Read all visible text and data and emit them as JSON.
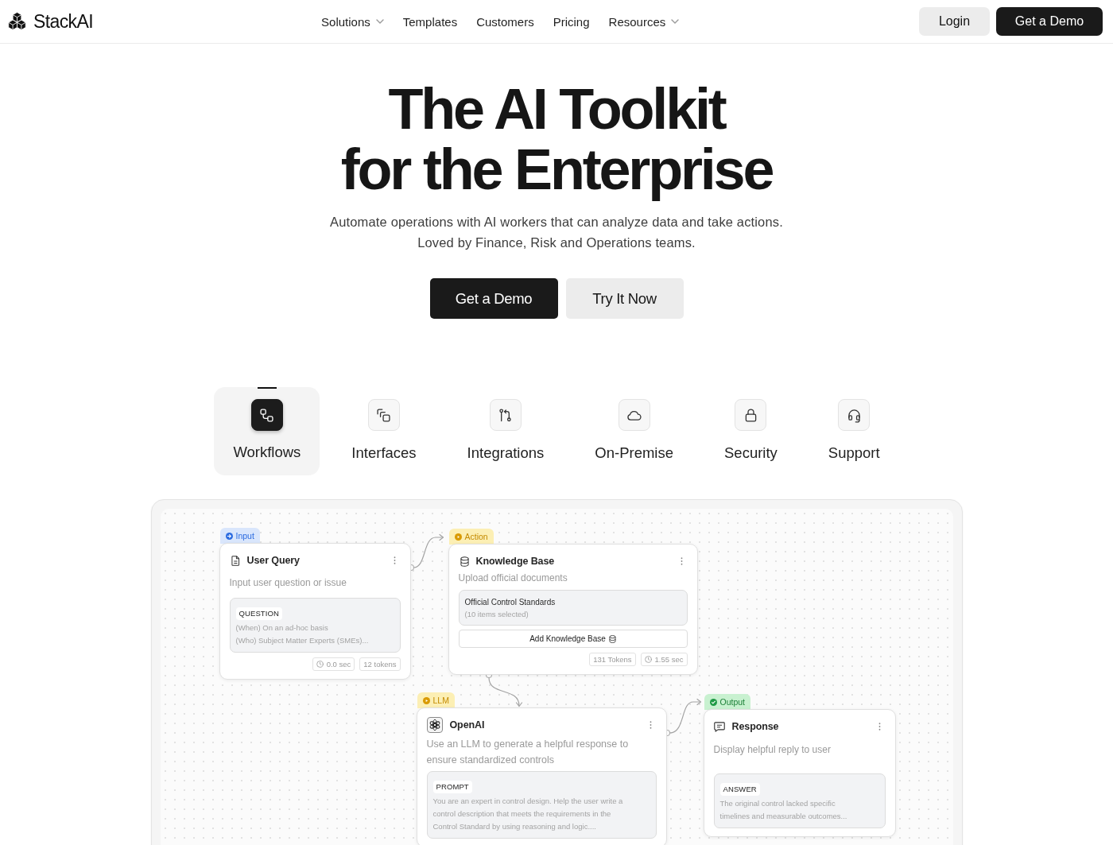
{
  "header": {
    "logo": "StackAI",
    "nav": [
      {
        "label": "Solutions",
        "dropdown": true
      },
      {
        "label": "Templates",
        "dropdown": false
      },
      {
        "label": "Customers",
        "dropdown": false
      },
      {
        "label": "Pricing",
        "dropdown": false
      },
      {
        "label": "Resources",
        "dropdown": true
      }
    ],
    "buttons": [
      {
        "label": "Login",
        "kind": "secondary"
      },
      {
        "label": "Get a Demo",
        "kind": "primary"
      }
    ]
  },
  "hero": {
    "title_lines": [
      "The AI Toolkit",
      "for the Enterprise"
    ],
    "subtitle_lines": [
      "Automate operations with AI workers that can analyze data and take actions.",
      "Loved by Finance, Risk and Operations teams."
    ],
    "buttons": [
      {
        "label": "Get a Demo",
        "kind": "primary"
      },
      {
        "label": "Try It Now",
        "kind": "secondary"
      }
    ]
  },
  "feature_tabs": [
    {
      "label": "Workflows",
      "selected": true
    },
    {
      "label": "Interfaces",
      "selected": false
    },
    {
      "label": "Integrations",
      "selected": false
    },
    {
      "label": "On-Premise",
      "selected": false
    },
    {
      "label": "Security",
      "selected": false
    },
    {
      "label": "Support",
      "selected": false
    }
  ],
  "workflow_canvas": {
    "nodes": [
      {
        "kind": "input",
        "tag": "Input",
        "title": "User Query",
        "description": "Input user question or issue",
        "field": {
          "kind": "tagged",
          "label": "QUESTION",
          "lines": [
            "(When) On an ad-hoc basis",
            "(Who) Subject Matter Experts (SMEs)..."
          ]
        },
        "stats": [
          {
            "kind": "time",
            "text": "0.0 sec"
          },
          {
            "kind": "tokens",
            "text": "12 tokens"
          }
        ]
      },
      {
        "kind": "action",
        "tag": "Action",
        "title": "Knowledge Base",
        "description": "Upload official documents",
        "field": {
          "kind": "source",
          "label": "Official Control Standards",
          "lines": [
            "(10 items selected)"
          ]
        },
        "button": "Add Knowledge Base",
        "stats": [
          {
            "kind": "tokens",
            "text": "131 Tokens"
          },
          {
            "kind": "time",
            "text": "1.55 sec"
          }
        ]
      },
      {
        "kind": "llm",
        "tag": "LLM",
        "title": "OpenAI",
        "description": "Use an LLM to generate a helpful response to ensure standardized controls",
        "field": {
          "kind": "tagged",
          "label": "PROMPT",
          "lines": [
            "You are an expert in control design. Help the user write a control description that meets the requirements in the Control Standard by using reasoning and logic...."
          ]
        }
      },
      {
        "kind": "output",
        "tag": "Output",
        "title": "Response",
        "description": "Display helpful reply to user",
        "field": {
          "kind": "tagged",
          "label": "ANSWER",
          "lines": [
            "The original control lacked specific timelines and measurable outcomes..."
          ]
        }
      }
    ]
  }
}
